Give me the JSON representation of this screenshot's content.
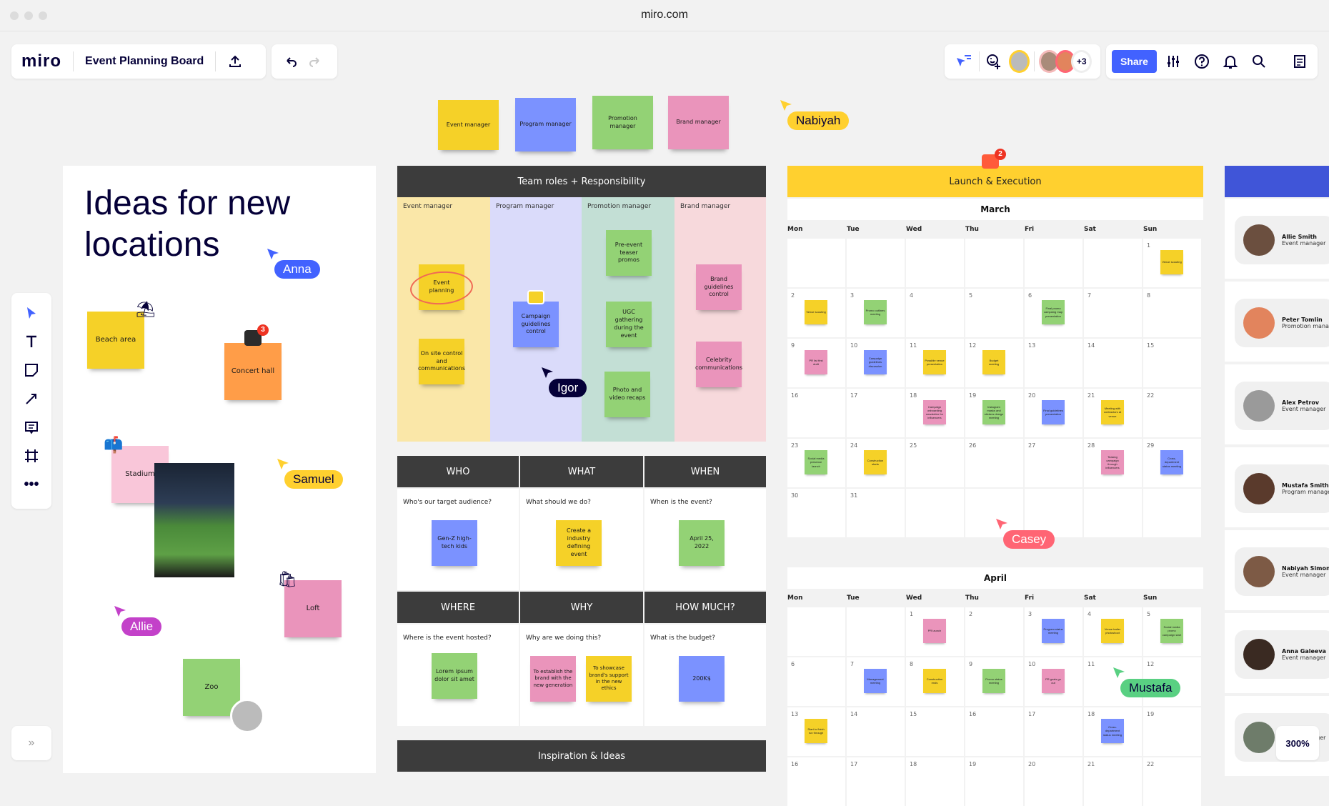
{
  "browser": {
    "url": "miro.com"
  },
  "header": {
    "logo": "miro",
    "board_title": "Event Planning Board",
    "share_label": "Share",
    "collaborators_more": "+3",
    "zoom_level": "300%"
  },
  "top_stickies": [
    {
      "text": "Event manager",
      "color": "yellow"
    },
    {
      "text": "Program manager",
      "color": "blue"
    },
    {
      "text": "Promotion manager",
      "color": "green"
    },
    {
      "text": "Brand manager",
      "color": "pink"
    }
  ],
  "ideas_frame": {
    "title": "Ideas for new locations",
    "stickies": [
      {
        "text": "Beach area",
        "color": "yellow",
        "emoji": "umbrella"
      },
      {
        "text": "Concert hall",
        "color": "orange",
        "comment_count": "3"
      },
      {
        "text": "Stadium",
        "color": "light-pink",
        "emoji": "mailbox"
      },
      {
        "text": "Loft",
        "color": "pink",
        "emoji": "shopping-bags"
      },
      {
        "text": "Zoo",
        "color": "green"
      }
    ]
  },
  "cursors": [
    {
      "name": "Nabiyah",
      "color": "#ffd02f"
    },
    {
      "name": "Anna",
      "color": "#4262ff"
    },
    {
      "name": "Samuel",
      "color": "#ffd02f"
    },
    {
      "name": "Allie",
      "color": "#c341c9"
    },
    {
      "name": "Igor",
      "color": "#050038"
    },
    {
      "name": "Casey",
      "color": "#ff6574"
    },
    {
      "name": "Mustafa",
      "color": "#59d082"
    }
  ],
  "team_roles": {
    "title": "Team roles + Responsibility",
    "lanes": [
      {
        "label": "Event manager",
        "stickies": [
          "Event planning",
          "On site control and communications"
        ]
      },
      {
        "label": "Program manager",
        "stickies": [
          "Campaign guidelines control"
        ]
      },
      {
        "label": "Promotion manager",
        "stickies": [
          "Pre-event teaser promos",
          "UGC gathering during the event",
          "Photo and video recaps"
        ]
      },
      {
        "label": "Brand manager",
        "stickies": [
          "Brand guidelines control",
          "Celebrity communications"
        ]
      }
    ]
  },
  "five_w": [
    {
      "header": "WHO",
      "question": "Who's our target audience?",
      "sticky": "Gen-Z high-tech kids"
    },
    {
      "header": "WHAT",
      "question": "What should we do?",
      "sticky": "Create a industry defining event"
    },
    {
      "header": "WHEN",
      "question": "When is the event?",
      "sticky": "April 25, 2022"
    },
    {
      "header": "WHERE",
      "question": "Where is the event hosted?",
      "sticky": "Lorem ipsum dolor sit amet"
    },
    {
      "header": "WHY",
      "question": "Why are we doing this?",
      "sticky": "To establish the brand with the new generation",
      "sticky2": "To showcase brand's support in the new ethics"
    },
    {
      "header": "HOW MUCH?",
      "question": "What is the budget?",
      "sticky": "200K$"
    }
  ],
  "inspiration": {
    "title": "Inspiration & Ideas"
  },
  "launch": {
    "title": "Launch & Execution",
    "comment_count": "2",
    "days": [
      "Mon",
      "Tue",
      "Wed",
      "Thu",
      "Fri",
      "Sat",
      "Sun"
    ],
    "march": {
      "title": "March",
      "cells": [
        "",
        "",
        "",
        "",
        "",
        "",
        "1",
        "2",
        "3",
        "4",
        "5",
        "6",
        "7",
        "8",
        "9",
        "10",
        "11",
        "12",
        "13",
        "14",
        "15",
        "16",
        "17",
        "18",
        "19",
        "20",
        "21",
        "22",
        "23",
        "24",
        "25",
        "26",
        "27",
        "28",
        "29",
        "30",
        "31",
        "",
        "",
        "",
        "",
        ""
      ],
      "events": [
        {
          "cell": 6,
          "text": "Venue scouting",
          "color": "y"
        },
        {
          "cell": 7,
          "text": "Venue scouting",
          "color": "y"
        },
        {
          "cell": 8,
          "text": "Promo outlines meeting",
          "color": "g"
        },
        {
          "cell": 11,
          "text": "Final promo campaing map presentation",
          "color": "g"
        },
        {
          "cell": 14,
          "text": "PR list first draft",
          "color": "p"
        },
        {
          "cell": 15,
          "text": "Campaign guidelines discussion",
          "color": "b"
        },
        {
          "cell": 16,
          "text": "Possible venue presentation",
          "color": "y"
        },
        {
          "cell": 17,
          "text": "Budget meeting",
          "color": "y"
        },
        {
          "cell": 23,
          "text": "Campaign onboarding newsletter for influencers",
          "color": "p"
        },
        {
          "cell": 24,
          "text": "Instagram masks and stickers design meeting",
          "color": "g"
        },
        {
          "cell": 25,
          "text": "Final guidelines presentation",
          "color": "b"
        },
        {
          "cell": 26,
          "text": "Meeting with contractors at venue",
          "color": "y"
        },
        {
          "cell": 28,
          "text": "Social media presence launch",
          "color": "g"
        },
        {
          "cell": 29,
          "text": "Construction starts",
          "color": "y"
        },
        {
          "cell": 33,
          "text": "Teasing campaign through influencers",
          "color": "p"
        },
        {
          "cell": 34,
          "text": "Cross-department status meeting",
          "color": "b"
        }
      ]
    },
    "april": {
      "title": "April",
      "cells": [
        "",
        "",
        "1",
        "2",
        "3",
        "4",
        "5",
        "6",
        "7",
        "8",
        "9",
        "10",
        "11",
        "12",
        "13",
        "14",
        "15",
        "16",
        "17",
        "18",
        "19",
        "16",
        "17",
        "18",
        "19",
        "20",
        "21",
        "22"
      ],
      "events": [
        {
          "cell": 2,
          "text": "PR launch",
          "color": "p"
        },
        {
          "cell": 4,
          "text": "Program status meeting",
          "color": "b"
        },
        {
          "cell": 5,
          "text": "Venue trailer photoshoot",
          "color": "y"
        },
        {
          "cell": 6,
          "text": "Social media promo campaign start",
          "color": "g"
        },
        {
          "cell": 8,
          "text": "Management meeting",
          "color": "b"
        },
        {
          "cell": 9,
          "text": "Construction ends",
          "color": "y"
        },
        {
          "cell": 10,
          "text": "Promo status meeting",
          "color": "g"
        },
        {
          "cell": 11,
          "text": "PR goals go out",
          "color": "p"
        },
        {
          "cell": 14,
          "text": "Start to finish run through",
          "color": "y"
        },
        {
          "cell": 19,
          "text": "Cross-department status meeting",
          "color": "b"
        }
      ]
    }
  },
  "people": [
    {
      "name": "Allie Smith",
      "role": "Event manager"
    },
    {
      "name": "Peter Tomlin",
      "role": "Promotion manager"
    },
    {
      "name": "Alex Petrov",
      "role": "Event manager"
    },
    {
      "name": "Mustafa Smith",
      "role": "Program manager"
    },
    {
      "name": "Nabiyah Simons",
      "role": "Event manager"
    },
    {
      "name": "Anna Galeeva",
      "role": "Event manager"
    },
    {
      "name": "",
      "role": "Event manager"
    }
  ],
  "colors": {
    "accent": "#4262ff",
    "launch_header": "#ffd02f",
    "dark_header": "#3c3c3c"
  }
}
